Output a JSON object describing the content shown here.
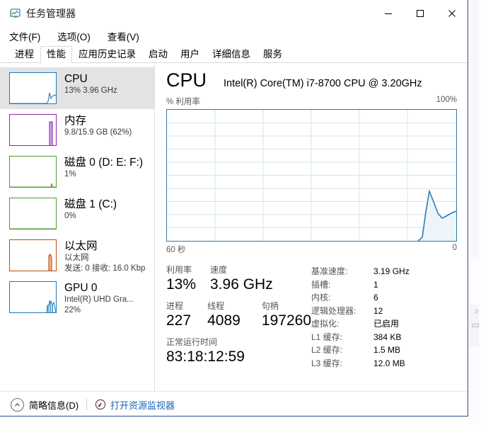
{
  "window": {
    "title": "任务管理器",
    "icon": "task-manager-monitor-icon",
    "controls": {
      "minimize": "—",
      "maximize": "□",
      "close": "✕"
    }
  },
  "menu": [
    {
      "label": "文件(F)"
    },
    {
      "label": "选项(O)"
    },
    {
      "label": "查看(V)"
    }
  ],
  "tabs": [
    {
      "label": "进程",
      "active": false
    },
    {
      "label": "性能",
      "active": true
    },
    {
      "label": "应用历史记录",
      "active": false
    },
    {
      "label": "启动",
      "active": false
    },
    {
      "label": "用户",
      "active": false
    },
    {
      "label": "详细信息",
      "active": false
    },
    {
      "label": "服务",
      "active": false
    }
  ],
  "sidebar": {
    "items": [
      {
        "name": "cpu",
        "title": "CPU",
        "sub1": "13%  3.96 GHz",
        "sub2": "",
        "sub3": "",
        "color": "#1f7bb6",
        "selected": true
      },
      {
        "name": "memory",
        "title": "内存",
        "sub1": "9.8/15.9 GB (62%)",
        "sub2": "",
        "sub3": "",
        "color": "#8b28a8",
        "selected": false
      },
      {
        "name": "disk-0",
        "title": "磁盘 0 (D: E: F:)",
        "sub1": "1%",
        "sub2": "",
        "sub3": "",
        "color": "#4a9c2c",
        "selected": false
      },
      {
        "name": "disk-1",
        "title": "磁盘 1 (C:)",
        "sub1": "0%",
        "sub2": "",
        "sub3": "",
        "color": "#4a9c2c",
        "selected": false
      },
      {
        "name": "ethernet",
        "title": "以太网",
        "sub1": "以太网",
        "sub2": "发送: 0 接收: 16.0 Kbp",
        "sub3": "",
        "color": "#b5520e",
        "selected": false
      },
      {
        "name": "gpu-0",
        "title": "GPU 0",
        "sub1": "Intel(R) UHD Gra...",
        "sub2": "22%",
        "sub3": "",
        "color": "#1f7bb6",
        "selected": false
      }
    ]
  },
  "main": {
    "title": "CPU",
    "model": "Intel(R) Core(TM) i7-8700 CPU @ 3.20GHz",
    "graph": {
      "y_label": "% 利用率",
      "y_max": "100%",
      "x_left": "60 秒",
      "x_right": "0",
      "line_color": "#2b7cb8",
      "fill_color": "#eef5fa",
      "grid_color": "#d3e4ef"
    },
    "stats": {
      "utilization_label": "利用率",
      "utilization_value": "13%",
      "speed_label": "速度",
      "speed_value": "3.96 GHz",
      "processes_label": "进程",
      "processes_value": "227",
      "threads_label": "线程",
      "threads_value": "4089",
      "handles_label": "句柄",
      "handles_value": "197260",
      "uptime_label": "正常运行时间",
      "uptime_value": "83:18:12:59"
    },
    "specs": [
      {
        "key": "基准速度:",
        "value": "3.19 GHz"
      },
      {
        "key": "插槽:",
        "value": "1"
      },
      {
        "key": "内核:",
        "value": "6"
      },
      {
        "key": "逻辑处理器:",
        "value": "12"
      },
      {
        "key": "虚拟化:",
        "value": "已启用"
      },
      {
        "key": "L1 缓存:",
        "value": "384 KB"
      },
      {
        "key": "L2 缓存:",
        "value": "1.5 MB"
      },
      {
        "key": "L3 缓存:",
        "value": "12.0 MB"
      }
    ]
  },
  "footer": {
    "fewer_details": "简略信息(D)",
    "resource_monitor": "打开资源监视器",
    "link_color": "#1667b1"
  },
  "chart_data": {
    "type": "area",
    "title": "% 利用率",
    "xlabel": "60 秒",
    "ylabel": "% 利用率",
    "ylim": [
      0,
      100
    ],
    "xlim": [
      60,
      0
    ],
    "grid": true,
    "grid_cols": 6,
    "grid_rows": 10,
    "series": [
      {
        "name": "CPU 利用率",
        "x": [
          60,
          56,
          52,
          48,
          44,
          40,
          36,
          32,
          28,
          24,
          20,
          16,
          12,
          8,
          6,
          5,
          4,
          3.2,
          2.6,
          2,
          1.4,
          0.8,
          0.4,
          0
        ],
        "values": [
          0,
          0,
          0,
          0,
          0,
          0,
          0,
          0,
          0,
          0,
          0,
          0,
          0,
          0,
          0,
          3,
          22,
          38,
          30,
          21,
          15,
          13,
          16,
          18
        ]
      }
    ]
  }
}
